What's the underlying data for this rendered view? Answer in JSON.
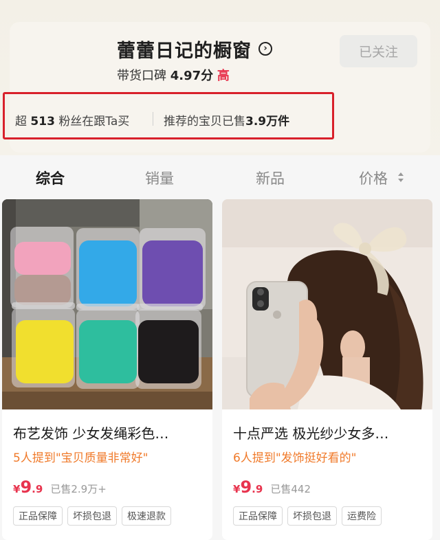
{
  "shop": {
    "title": "蕾蕾日记的橱窗",
    "title_arrow": "›",
    "rating_label": "带货口碑",
    "rating_score": "4.97分",
    "rating_grade": "高",
    "follow_label": "已关注"
  },
  "stats": {
    "fans_prefix": "超",
    "fans_count": "513",
    "fans_suffix": "粉丝在跟Ta买",
    "sold_prefix": "推荐的宝贝已售",
    "sold_value": "3.9万件"
  },
  "tabs": [
    {
      "label": "综合"
    },
    {
      "label": "销量"
    },
    {
      "label": "新品"
    },
    {
      "label": "价格"
    }
  ],
  "products": [
    {
      "title": "布艺发饰 少女发绳彩色…",
      "review": "5人提到\"宝贝质量非常好\"",
      "price_symbol": "¥",
      "price_int": "9",
      "price_dec": ".9",
      "sold": "已售2.9万+",
      "tags": [
        "正品保障",
        "坏损包退",
        "极速退款"
      ],
      "image": "hair-ties-jars-image"
    },
    {
      "title": "十点严选 极光纱少女多…",
      "review": "6人提到\"发饰挺好看的\"",
      "price_symbol": "¥",
      "price_int": "9",
      "price_dec": ".9",
      "sold": "已售442",
      "tags": [
        "正品保障",
        "坏损包退",
        "运费险"
      ],
      "image": "girl-with-bow-image"
    }
  ],
  "colors": {
    "accent_red": "#e8344e",
    "review_orange": "#f07a2a",
    "highlight_box": "#d8202a"
  }
}
